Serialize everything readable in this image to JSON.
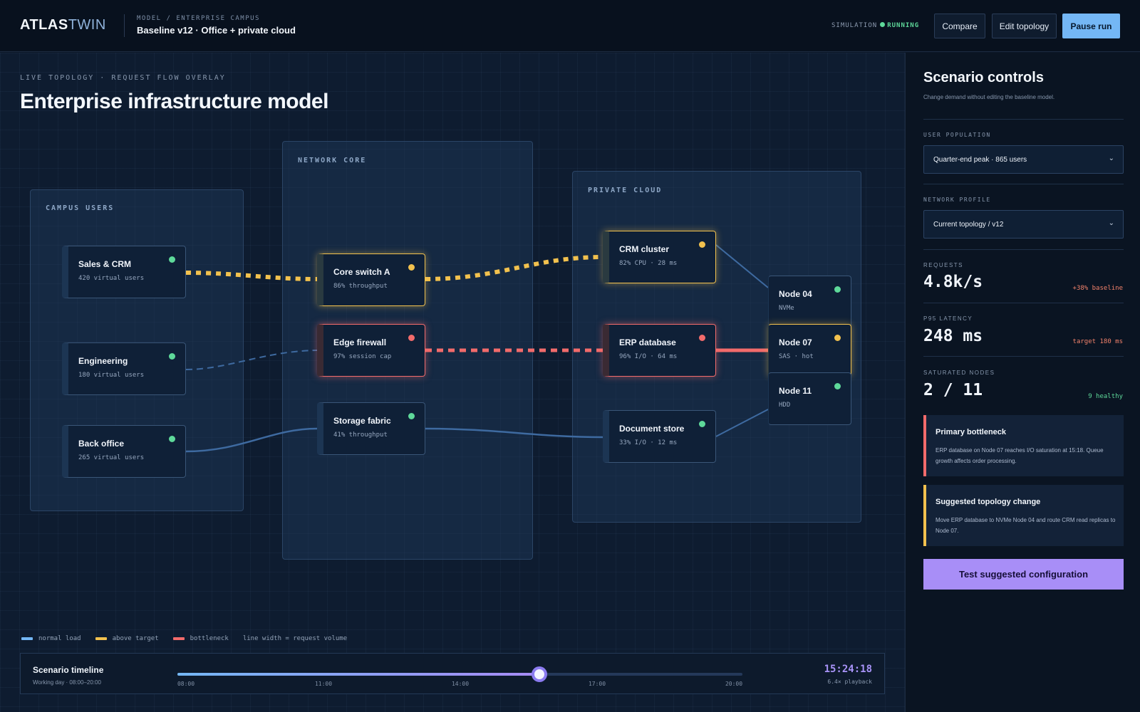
{
  "brand": {
    "part1": "ATLAS",
    "part2": "TWIN"
  },
  "header": {
    "breadcrumb": "MODEL / ENTERPRISE CAMPUS",
    "model_title": "Baseline v12 · Office + private cloud",
    "sim_label": "SIMULATION",
    "sim_state": "RUNNING",
    "buttons": {
      "compare": "Compare",
      "edit": "Edit topology",
      "pause": "Pause run"
    }
  },
  "canvas": {
    "eyebrow": "LIVE TOPOLOGY · REQUEST FLOW OVERLAY",
    "title": "Enterprise infrastructure model",
    "zones": {
      "campus": "CAMPUS USERS",
      "core": "NETWORK CORE",
      "cloud": "PRIVATE CLOUD"
    },
    "nodes": {
      "sales": {
        "name": "Sales & CRM",
        "sub": "420 virtual users",
        "status": "ok"
      },
      "engineering": {
        "name": "Engineering",
        "sub": "180 virtual users",
        "status": "ok"
      },
      "backoffice": {
        "name": "Back office",
        "sub": "265 virtual users",
        "status": "ok"
      },
      "core_switch": {
        "name": "Core switch A",
        "sub": "86% throughput",
        "status": "above-target"
      },
      "edge_firewall": {
        "name": "Edge firewall",
        "sub": "97% session cap",
        "status": "bottleneck"
      },
      "storage_fabric": {
        "name": "Storage fabric",
        "sub": "41% throughput",
        "status": "ok"
      },
      "crm_cluster": {
        "name": "CRM cluster",
        "sub": "82% CPU · 28 ms",
        "status": "above-target"
      },
      "erp_database": {
        "name": "ERP database",
        "sub": "96% I/O · 64 ms",
        "status": "bottleneck"
      },
      "document_store": {
        "name": "Document store",
        "sub": "33% I/O · 12 ms",
        "status": "ok"
      },
      "node04": {
        "name": "Node 04",
        "sub": "NVMe",
        "status": "ok"
      },
      "node07": {
        "name": "Node 07",
        "sub": "SAS · hot",
        "status": "above-target"
      },
      "node11": {
        "name": "Node 11",
        "sub": "HDD",
        "status": "ok"
      }
    },
    "legend": {
      "normal": "normal load",
      "above": "above target",
      "bottleneck": "bottleneck",
      "note": "line width = request volume"
    },
    "colors": {
      "normal": "#5b8fd6",
      "above_target": "#f2c14e",
      "bottleneck": "#f26b6b",
      "ok": "#5ed99a"
    }
  },
  "timeline": {
    "title": "Scenario timeline",
    "subtitle": "Working day · 08:00–20:00",
    "ticks": [
      "08:00",
      "11:00",
      "14:00",
      "17:00",
      "20:00"
    ],
    "progress": 0.64,
    "clock": "15:24:18",
    "playback": "6.4× playback"
  },
  "panel": {
    "title": "Scenario controls",
    "subtitle": "Change demand without editing the baseline model.",
    "user_population": {
      "label": "USER POPULATION",
      "value": "Quarter-end peak · 865 users"
    },
    "network_profile": {
      "label": "NETWORK PROFILE",
      "value": "Current topology / v12"
    },
    "metrics": {
      "requests": {
        "label": "REQUESTS",
        "value": "4.8k/s",
        "note": "+38% baseline"
      },
      "latency": {
        "label": "P95 LATENCY",
        "value": "248 ms",
        "note": "target 180 ms"
      },
      "saturated": {
        "label": "SATURATED NODES",
        "value": "2 / 11",
        "note": "9 healthy"
      }
    },
    "bottleneck_card": {
      "title": "Primary bottleneck",
      "body": "ERP database on Node 07 reaches I/O saturation at 15:18. Queue growth affects order processing."
    },
    "suggestion_card": {
      "title": "Suggested topology change",
      "body": "Move ERP database to NVMe Node 04 and route CRM read replicas to Node 07."
    },
    "cta": "Test suggested configuration"
  }
}
